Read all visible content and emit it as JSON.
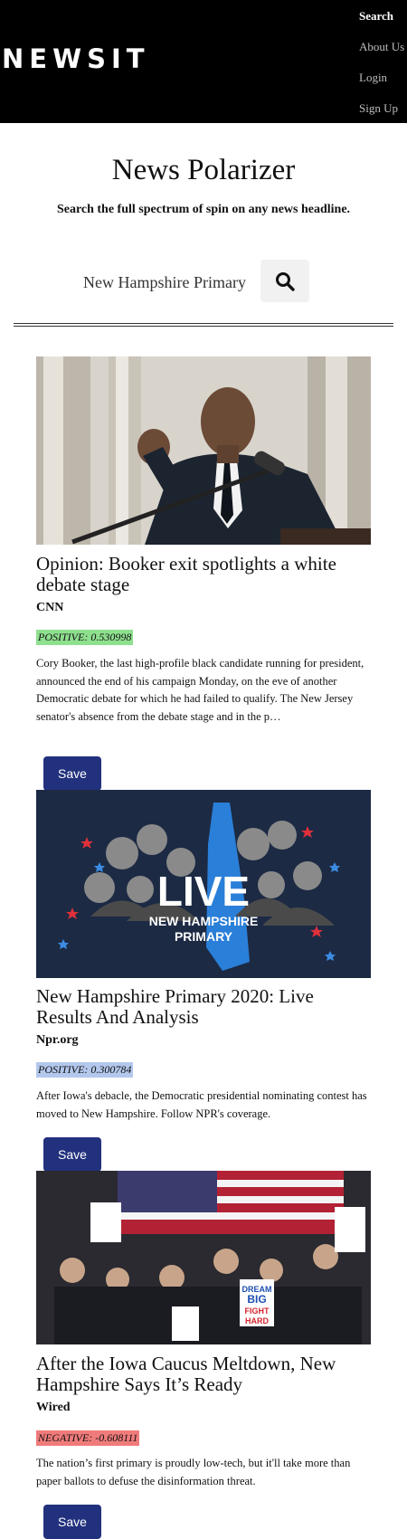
{
  "brand": {
    "logo": "NEWSIT"
  },
  "nav": {
    "items": [
      {
        "label": "Search",
        "active": true
      },
      {
        "label": "About Us",
        "active": false
      },
      {
        "label": "Login",
        "active": false
      },
      {
        "label": "Sign Up",
        "active": false
      }
    ]
  },
  "hero": {
    "title": "News Polarizer",
    "subtitle": "Search the full spectrum of spin on any news headline."
  },
  "search": {
    "value": "New Hampshire Primary",
    "icon": "search-icon"
  },
  "articles": [
    {
      "title": "Opinion: Booker exit spotlights a white debate stage",
      "source": "CNN",
      "sentiment_label": "POSITIVE:",
      "sentiment_value": "0.530998",
      "sentiment_color": "#8ee08e",
      "summary": "Cory Booker, the last high-profile black candidate running for president, announced the end of his campaign Monday, on the eve of another Democratic debate for which he had failed to qualify. The New Jersey senator's absence from the debate stage and in the p…",
      "save_label": "Save"
    },
    {
      "title": "New Hampshire Primary 2020: Live Results And Analysis",
      "source": "Npr.org",
      "sentiment_label": "POSITIVE:",
      "sentiment_value": "0.300784",
      "sentiment_color": "#b3c8ec",
      "summary": "After Iowa's debacle, the Democratic presidential nominating contest has moved to New Hampshire. Follow NPR's coverage.",
      "save_label": "Save",
      "image_text": {
        "big": "LIVE",
        "line1": "NEW HAMPSHIRE",
        "line2": "PRIMARY"
      }
    },
    {
      "title": "After the Iowa Caucus Meltdown, New Hampshire Says It’s Ready",
      "source": "Wired",
      "sentiment_label": "NEGATIVE:",
      "sentiment_value": "-0.608111",
      "sentiment_color": "#f07b7b",
      "summary": "The nation’s first primary is proudly low-tech, but it'll take more than paper ballots to defuse the disinformation threat.",
      "save_label": "Save",
      "image_text": {
        "sign_line1": "DREAM",
        "sign_line2": "BIG",
        "sign_line3": "FIGHT",
        "sign_line4": "HARD"
      }
    }
  ]
}
